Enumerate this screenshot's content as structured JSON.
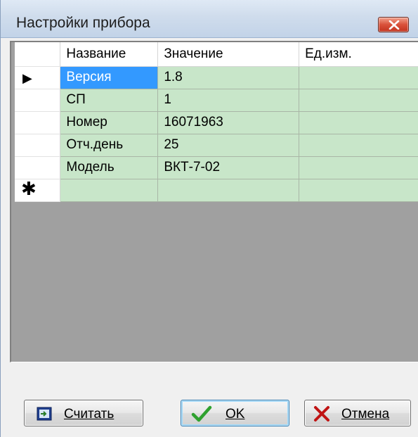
{
  "window": {
    "title": "Настройки прибора"
  },
  "grid": {
    "columns": [
      "Название",
      "Значение",
      "Ед.изм."
    ],
    "current_row_marker": "▶",
    "new_row_marker": "✱",
    "rows": [
      {
        "name": "Версия",
        "value": "1.8",
        "unit": ""
      },
      {
        "name": "СП",
        "value": "1",
        "unit": ""
      },
      {
        "name": "Номер",
        "value": "16071963",
        "unit": ""
      },
      {
        "name": "Отч.день",
        "value": "25",
        "unit": ""
      },
      {
        "name": "Модель",
        "value": "ВКТ-7-02",
        "unit": ""
      }
    ]
  },
  "buttons": {
    "read_label": "Считать",
    "ok_label": "OK",
    "cancel_label": "Отмена"
  },
  "icons": {
    "close": "close-icon",
    "read": "read-device-icon",
    "ok": "checkmark-icon",
    "cancel": "cross-icon"
  },
  "colors": {
    "cell_background": "#c8e6c9",
    "selected_cell": "#3399ff",
    "grid_background": "#a0a0a0",
    "close_button": "#d9513a",
    "ok_check": "#2fa12f",
    "cancel_cross": "#c01414"
  }
}
